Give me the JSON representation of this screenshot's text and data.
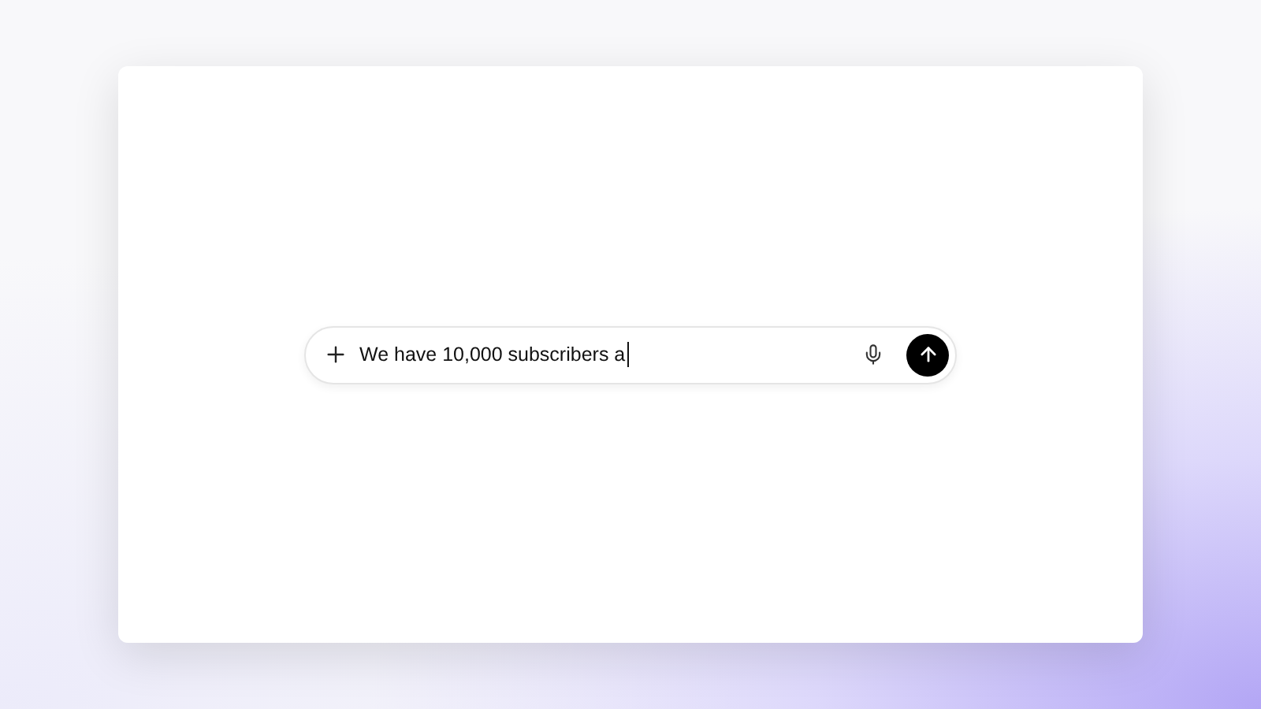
{
  "composer": {
    "value": "We have 10,000 subscribers a"
  }
}
